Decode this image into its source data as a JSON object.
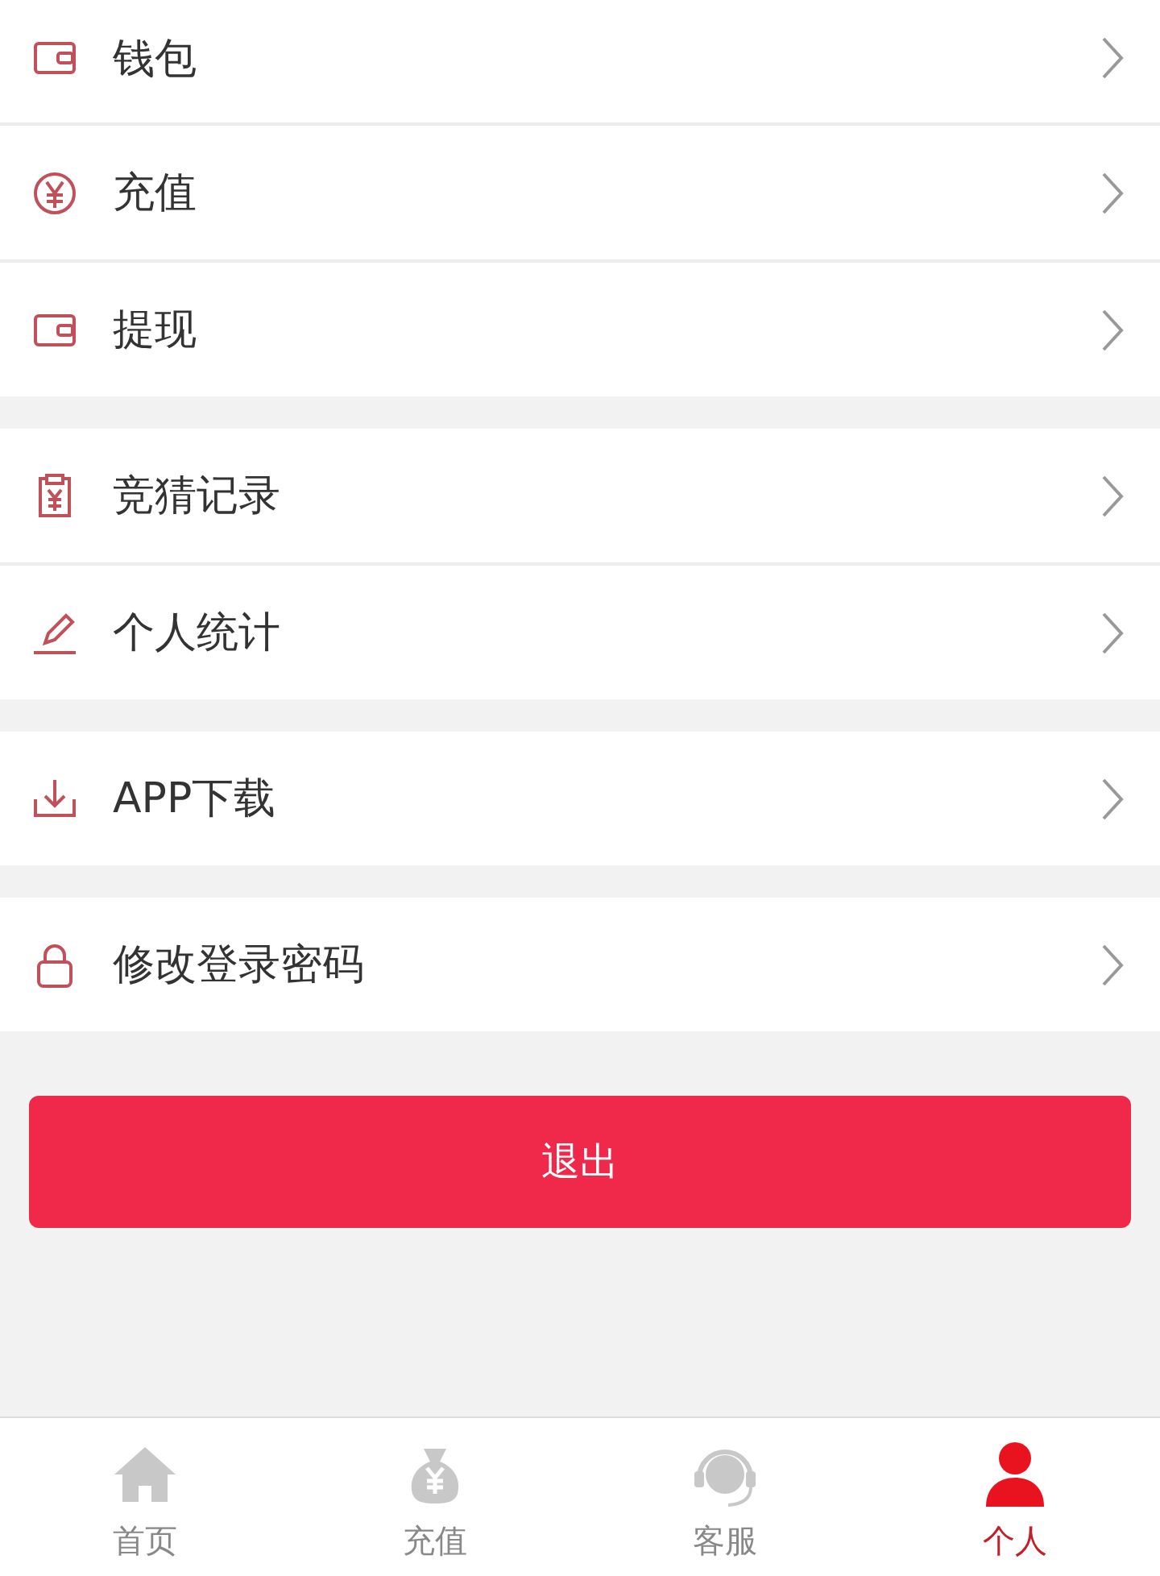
{
  "menu_groups": [
    {
      "items": [
        {
          "kind": "wallet",
          "label": "钱包"
        },
        {
          "kind": "coin",
          "label": "充值"
        },
        {
          "kind": "wallet",
          "label": "提现"
        }
      ]
    },
    {
      "items": [
        {
          "kind": "clipboard",
          "label": "竞猜记录"
        },
        {
          "kind": "pen",
          "label": "个人统计"
        }
      ]
    },
    {
      "items": [
        {
          "kind": "download",
          "label": "APP下载"
        }
      ]
    },
    {
      "items": [
        {
          "kind": "lock",
          "label": "修改登录密码"
        }
      ]
    }
  ],
  "logout_button": {
    "label": "退出"
  },
  "tab_bar": [
    {
      "kind": "home",
      "label": "首页",
      "selected": false
    },
    {
      "kind": "bag",
      "label": "充值",
      "selected": false
    },
    {
      "kind": "headset",
      "label": "客服",
      "selected": false
    },
    {
      "kind": "person",
      "label": "个人",
      "selected": true
    }
  ]
}
